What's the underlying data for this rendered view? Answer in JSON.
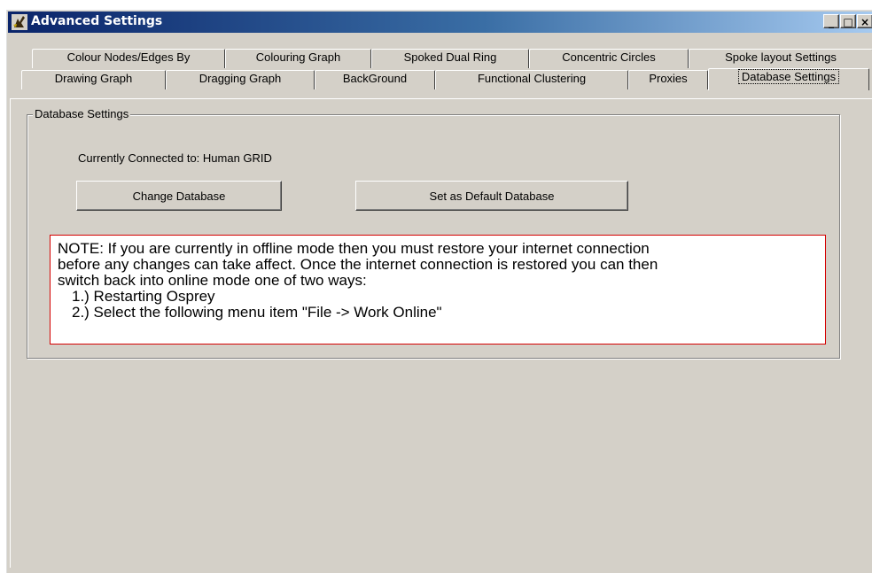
{
  "window": {
    "title": "Advanced Settings",
    "controls": {
      "minimize": "_",
      "maximize": "□",
      "close": "×"
    }
  },
  "tabs": {
    "row_back": [
      "Colour Nodes/Edges By",
      "Colouring Graph",
      "Spoked Dual Ring",
      "Concentric Circles",
      "Spoke layout Settings"
    ],
    "row_front": [
      "Drawing Graph",
      "Dragging Graph",
      "BackGround",
      "Functional Clustering",
      "Proxies",
      "Database Settings"
    ],
    "active": "Database Settings"
  },
  "panel": {
    "group_title": "Database Settings",
    "connection_text": "Currently Connected to: Human GRID",
    "buttons": {
      "change": "Change Database",
      "set_default": "Set as Default Database"
    },
    "note": {
      "lines": [
        "NOTE: If you are currently in offline mode then you must restore your internet connection",
        "before any changes can take affect. Once the internet connection is restored you can then",
        "switch back into online mode one of two ways:"
      ],
      "items": [
        "1.) Restarting Osprey",
        "2.) Select the following menu item \"File -> Work Online\""
      ],
      "border_color": "#d40000"
    }
  },
  "colors": {
    "face": "#d4d0c8",
    "titlebar_start": "#0a246a",
    "titlebar_end": "#a6caf0"
  }
}
